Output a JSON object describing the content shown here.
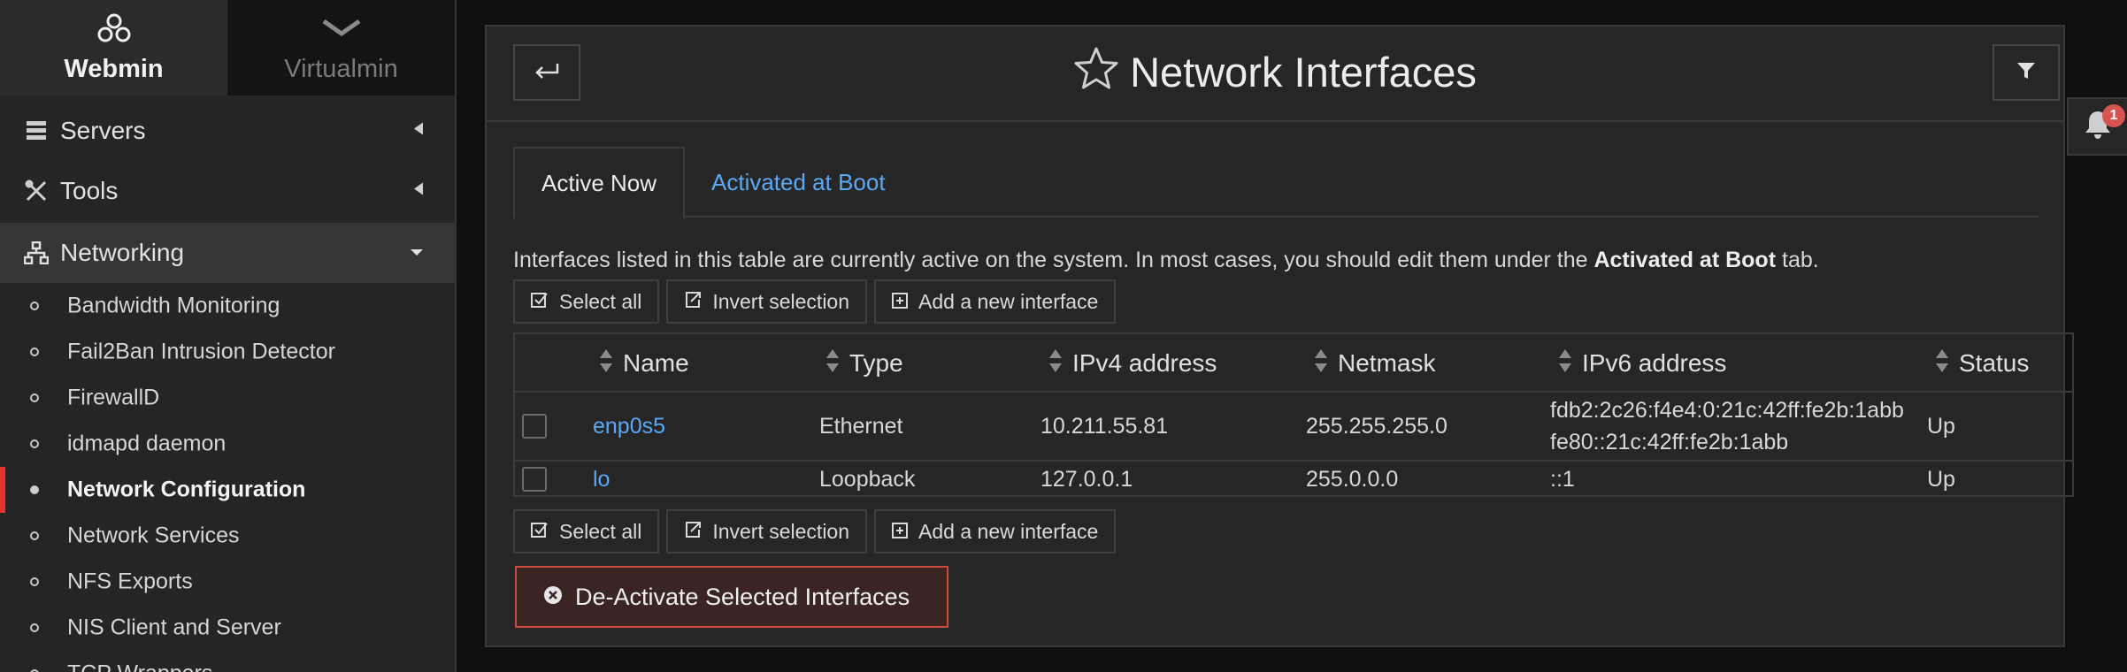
{
  "sidebar": {
    "switch_tabs": [
      {
        "label": "Webmin",
        "icon": "webmin-logo-icon",
        "active": true
      },
      {
        "label": "Virtualmin",
        "icon": "virtualmin-logo-icon",
        "active": false
      }
    ],
    "categories": [
      {
        "label": "Servers",
        "icon": "server-icon",
        "open": false
      },
      {
        "label": "Tools",
        "icon": "tools-icon",
        "open": false
      },
      {
        "label": "Networking",
        "icon": "network-icon",
        "open": true
      }
    ],
    "items": [
      {
        "label": "Bandwidth Monitoring"
      },
      {
        "label": "Fail2Ban Intrusion Detector"
      },
      {
        "label": "FirewallD"
      },
      {
        "label": "idmapd daemon"
      },
      {
        "label": "Network Configuration",
        "active": true
      },
      {
        "label": "Network Services"
      },
      {
        "label": "NFS Exports"
      },
      {
        "label": "NIS Client and Server"
      },
      {
        "label": "TCP Wrappers"
      }
    ]
  },
  "header": {
    "title": "Network Interfaces",
    "back_icon": "back-arrow-icon",
    "filter_icon": "filter-icon",
    "star_icon": "star-icon"
  },
  "tabs": [
    {
      "label": "Active Now",
      "active": true
    },
    {
      "label": "Activated at Boot",
      "active": false
    }
  ],
  "description": {
    "text": "Interfaces listed in this table are currently active on the system. In most cases, you should edit them under the ",
    "bold": "Activated at Boot",
    "tail": " tab."
  },
  "actions": {
    "select_all": "Select all",
    "invert_selection": "Invert selection",
    "add_interface": "Add a new interface"
  },
  "table": {
    "columns": [
      "Name",
      "Type",
      "IPv4 address",
      "Netmask",
      "IPv6 address",
      "Status"
    ],
    "rows": [
      {
        "name": "enp0s5",
        "type": "Ethernet",
        "ipv4": "10.211.55.81",
        "netmask": "255.255.255.0",
        "ipv6_1": "fdb2:2c26:f4e4:0:21c:42ff:fe2b:1abb",
        "ipv6_2": "fe80::21c:42ff:fe2b:1abb",
        "status": "Up"
      },
      {
        "name": "lo",
        "type": "Loopback",
        "ipv4": "127.0.0.1",
        "netmask": "255.0.0.0",
        "ipv6_1": "::1",
        "ipv6_2": "",
        "status": "Up"
      }
    ]
  },
  "deactivate_button": "De-Activate Selected Interfaces",
  "notifications": {
    "count": "1",
    "icon": "bell-icon"
  },
  "colors": {
    "link": "#5ba8f5",
    "danger": "#cc4b3e",
    "active_bar": "#e3342f"
  }
}
